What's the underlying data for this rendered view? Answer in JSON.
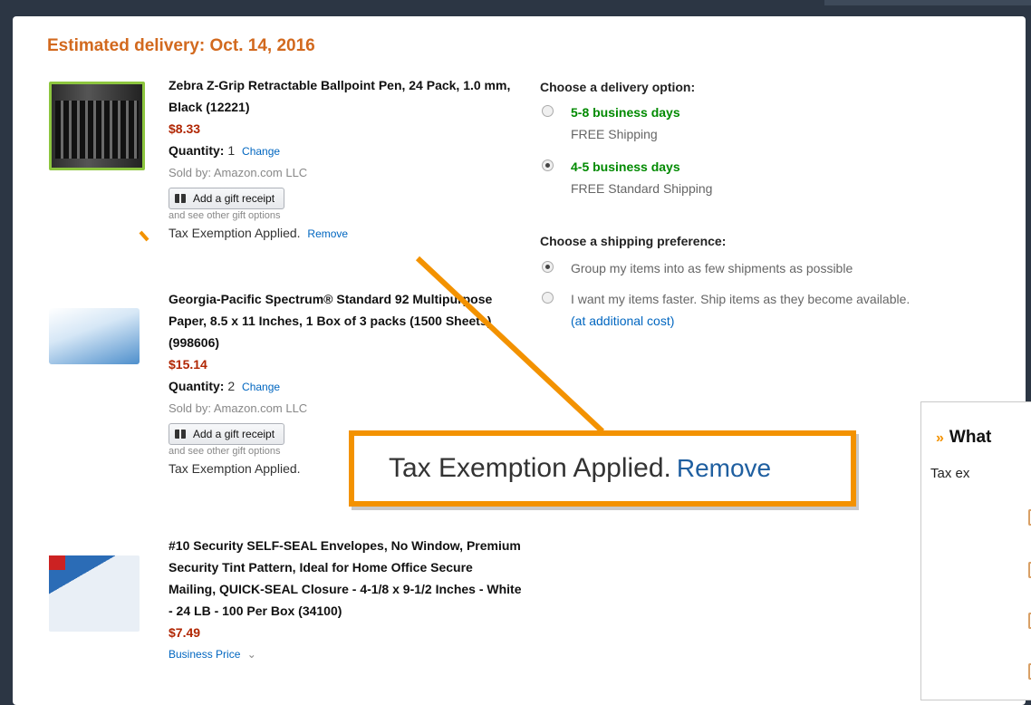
{
  "delivery": {
    "heading": "Estimated delivery:  Oct. 14, 2016"
  },
  "items": [
    {
      "title": "Zebra Z-Grip Retractable Ballpoint Pen, 24 Pack, 1.0 mm, Black (12221)",
      "price": "$8.33",
      "quantity_label": "Quantity:",
      "quantity_value": "1",
      "change_label": "Change",
      "sold_by": "Sold by: Amazon.com LLC",
      "gift_button": "Add a gift receipt",
      "gift_sub": "and see other gift options",
      "tax_text": "Tax Exemption Applied.",
      "remove_label": "Remove"
    },
    {
      "title": "Georgia-Pacific Spectrum® Standard 92 Multipurpose Paper, 8.5 x 11 Inches, 1 Box of 3 packs (1500 Sheets) (998606)",
      "price": "$15.14",
      "quantity_label": "Quantity:",
      "quantity_value": "2",
      "change_label": "Change",
      "sold_by": "Sold by: Amazon.com LLC",
      "gift_button": "Add a gift receipt",
      "gift_sub": "and see other gift options",
      "tax_text": "Tax Exemption Applied."
    },
    {
      "title": "#10 Security SELF-SEAL Envelopes, No Window, Premium Security Tint Pattern, Ideal for Home Office Secure Mailing, QUICK-SEAL Closure - 4-1/8 x 9-1/2 Inches - White - 24 LB - 100 Per Box (34100)",
      "price": "$7.49",
      "business_price": "Business Price"
    }
  ],
  "delivery_options": {
    "heading": "Choose a delivery option:",
    "options": [
      {
        "speed": "5-8 business days",
        "shipping": "FREE Shipping",
        "selected": false
      },
      {
        "speed": "4-5 business days",
        "shipping": "FREE Standard Shipping",
        "selected": true
      }
    ]
  },
  "shipping_preference": {
    "heading": "Choose a shipping preference:",
    "options": [
      {
        "text": "Group my items into as few shipments as possible",
        "selected": true
      },
      {
        "text": "I want my items faster. Ship items as they become available.",
        "note": "(at additional cost)",
        "selected": false
      }
    ]
  },
  "callout": {
    "text": "Tax Exemption Applied.",
    "remove_label": "Remove",
    "accent": "#f39200"
  },
  "side_panel": {
    "title": "What",
    "subtitle": "Tax ex"
  }
}
